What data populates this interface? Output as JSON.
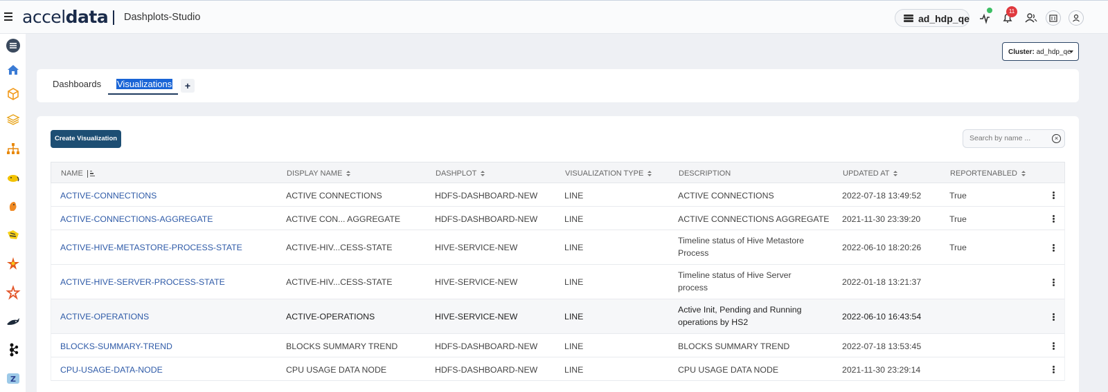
{
  "header": {
    "logo_prefix": "accel",
    "logo_suffix": "data",
    "app_name": "Dashplots-Studio",
    "cluster_chip": "ad_hdp_qe",
    "notification_count": "11",
    "icons": [
      "menu-icon",
      "database-icon",
      "pulse-icon",
      "bell-icon",
      "users-icon",
      "building-icon",
      "user-icon"
    ]
  },
  "sidebar": {
    "icons": [
      "list-icon",
      "home-icon",
      "cube-icon",
      "layers-icon",
      "sitemap-icon",
      "hadoop-elephant-icon",
      "squirrel-icon",
      "hive-bee-icon",
      "spark-star-icon",
      "kafka-star-icon",
      "orca-icon",
      "kafka-nodes-icon",
      "zookeeper-icon"
    ]
  },
  "cluster_select": {
    "label": "Cluster:",
    "value": "ad_hdp_qe"
  },
  "tabs": [
    {
      "label": "Dashboards",
      "active": false
    },
    {
      "label": "Visualizations",
      "active": true
    }
  ],
  "tab_add": "+",
  "toolbar": {
    "create_label": "Create Visualization",
    "search_placeholder": "Search by name ..."
  },
  "table": {
    "columns": [
      "NAME",
      "DISPLAY NAME",
      "DASHPLOT",
      "VISUALIZATION TYPE",
      "DESCRIPTION",
      "UPDATED AT",
      "REPORTENABLED"
    ],
    "rows": [
      {
        "name": "ACTIVE-CONNECTIONS",
        "display": "ACTIVE CONNECTIONS",
        "dashplot": "HDFS-DASHBOARD-NEW",
        "type": "LINE",
        "description": "ACTIVE CONNECTIONS",
        "updated": "2022-07-18 13:49:52",
        "report": "True"
      },
      {
        "name": "ACTIVE-CONNECTIONS-AGGREGATE",
        "display": "ACTIVE CON... AGGREGATE",
        "dashplot": "HDFS-DASHBOARD-NEW",
        "type": "LINE",
        "description": "ACTIVE CONNECTIONS AGGREGATE",
        "updated": "2021-11-30 23:39:20",
        "report": "True"
      },
      {
        "name": "ACTIVE-HIVE-METASTORE-PROCESS-STATE",
        "display": "ACTIVE-HIV...CESS-STATE",
        "dashplot": "HIVE-SERVICE-NEW",
        "type": "LINE",
        "description": "Timeline status of Hive Metastore Process",
        "updated": "2022-06-10 18:20:26",
        "report": "True"
      },
      {
        "name": "ACTIVE-HIVE-SERVER-PROCESS-STATE",
        "display": "ACTIVE-HIV...CESS-STATE",
        "dashplot": "HIVE-SERVICE-NEW",
        "type": "LINE",
        "description": "Timeline status of Hive Server process",
        "updated": "2022-01-18 13:21:37",
        "report": ""
      },
      {
        "name": "ACTIVE-OPERATIONS",
        "display": "ACTIVE-OPERATIONS",
        "dashplot": "HIVE-SERVICE-NEW",
        "type": "LINE",
        "description": "Active Init, Pending and Running operations by HS2",
        "updated": "2022-06-10 16:43:54",
        "report": ""
      },
      {
        "name": "BLOCKS-SUMMARY-TREND",
        "display": "BLOCKS SUMMARY TREND",
        "dashplot": "HDFS-DASHBOARD-NEW",
        "type": "LINE",
        "description": "BLOCKS SUMMARY TREND",
        "updated": "2022-07-18 13:53:45",
        "report": ""
      },
      {
        "name": "CPU-USAGE-DATA-NODE",
        "display": "CPU USAGE DATA NODE",
        "dashplot": "HDFS-DASHBOARD-NEW",
        "type": "LINE",
        "description": "CPU USAGE DATA NODE",
        "updated": "2021-11-30 23:29:14",
        "report": ""
      }
    ]
  },
  "colors": {
    "primary_button": "#1d4e73",
    "link": "#2f5ba8",
    "tab_highlight": "#1a65d6",
    "badge": "#e0393e",
    "status_dot": "#3cbf64"
  }
}
